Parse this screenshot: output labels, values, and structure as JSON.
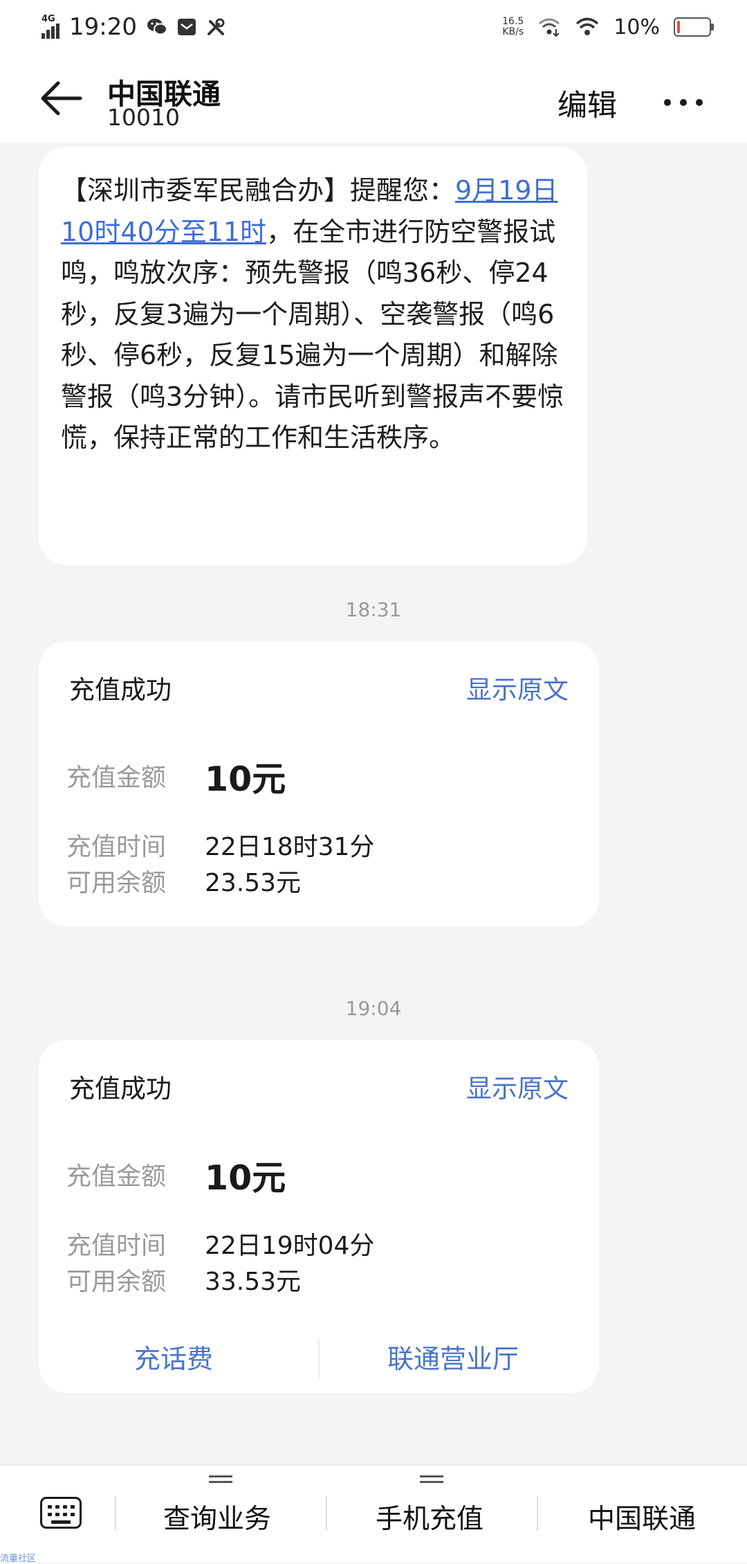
{
  "status_bar": {
    "network": "4G",
    "time": "19:20",
    "speed_value": "16.5",
    "speed_unit": "KB/s",
    "battery_percent": "10%",
    "battery_level": 0.1,
    "left_icons": [
      "signal-icon",
      "wechat-icon",
      "message-icon",
      "tools-icon"
    ],
    "right_icons": [
      "wifi-call-icon",
      "wifi-icon",
      "battery-icon"
    ]
  },
  "header": {
    "contact_name": "中国联通",
    "contact_number": "10010",
    "edit_label": "编辑"
  },
  "messages": {
    "sms1": {
      "text_before_link": "【深圳市委军民融合办】提醒您：",
      "link_text": "9月19日10时40分至11时",
      "text_after_link": "，在全市进行防空警报试鸣，鸣放次序：预先警报（鸣36秒、停24秒，反复3遍为一个周期）、空袭警报（鸣6秒、停6秒，反复15遍为一个周期）和解除警报（鸣3分钟）。请市民听到警报声不要惊慌，保持正常的工作和生活秩序。"
    },
    "timestamp1": "18:31",
    "card1": {
      "title": "充值成功",
      "show_original": "显示原文",
      "amount_label": "充值金额",
      "amount_value": "10元",
      "time_label": "充值时间",
      "time_value": "22日18时31分",
      "balance_label": "可用余额",
      "balance_value": "23.53元"
    },
    "timestamp2": "19:04",
    "card2": {
      "title": "充值成功",
      "show_original": "显示原文",
      "amount_label": "充值金额",
      "amount_value": "10元",
      "time_label": "充值时间",
      "time_value": "22日19时04分",
      "balance_label": "可用余额",
      "balance_value": "33.53元",
      "action_recharge": "充话费",
      "action_office": "联通营业厅"
    }
  },
  "bottom_menu": {
    "item1": "查询业务",
    "item2": "手机充值",
    "item3": "中国联通"
  },
  "watermark": "流量社区",
  "colors": {
    "link": "#3e6ed4",
    "accent": "#4a74c9",
    "battery_low": "#e54a3c",
    "background": "#f4f4f4"
  }
}
